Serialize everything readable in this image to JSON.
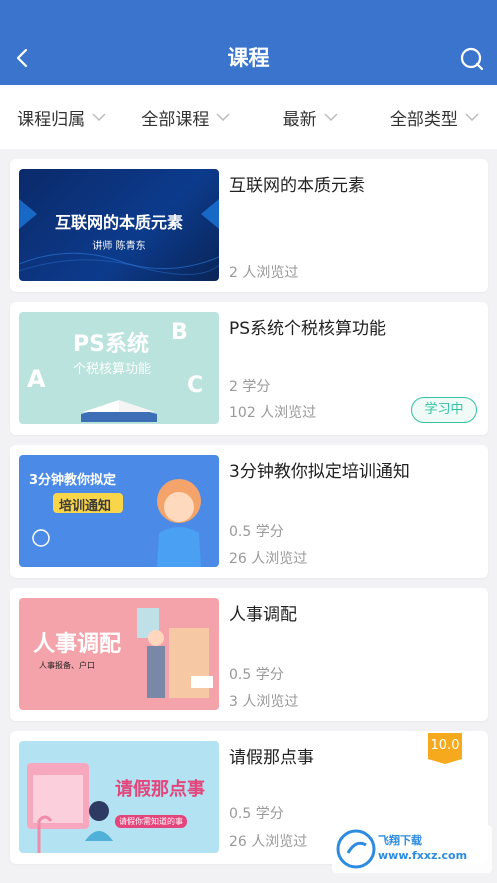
{
  "header": {
    "title": "课程"
  },
  "filters": [
    "课程归属",
    "全部课程",
    "最新",
    "全部类型"
  ],
  "courses": [
    {
      "title": "互联网的本质元素",
      "thumb_title": "互联网的本质元素",
      "thumb_sub": "讲师 陈青东",
      "views": "2 人浏览过"
    },
    {
      "title": "PS系统个税核算功能",
      "thumb_title": "PS系统",
      "thumb_sub": "个税核算功能",
      "credits": "2 学分",
      "views": "102 人浏览过",
      "badge": "学习中"
    },
    {
      "title": "3分钟教你拟定培训通知",
      "thumb_title": "3分钟教你拟定",
      "thumb_sub": "培训通知",
      "credits": "0.5 学分",
      "views": "26 人浏览过"
    },
    {
      "title": "人事调配",
      "thumb_title": "人事调配",
      "thumb_sub": "人事报备、户口",
      "credits": "0.5 学分",
      "views": "3 人浏览过"
    },
    {
      "title": "请假那点事",
      "thumb_title": "请假那点事",
      "thumb_sub": "请假你需知道的事",
      "credits": "0.5 学分",
      "views": "26 人浏览过",
      "score": "10.0"
    }
  ],
  "watermark": "飞翔下载 www.fxxz.com"
}
